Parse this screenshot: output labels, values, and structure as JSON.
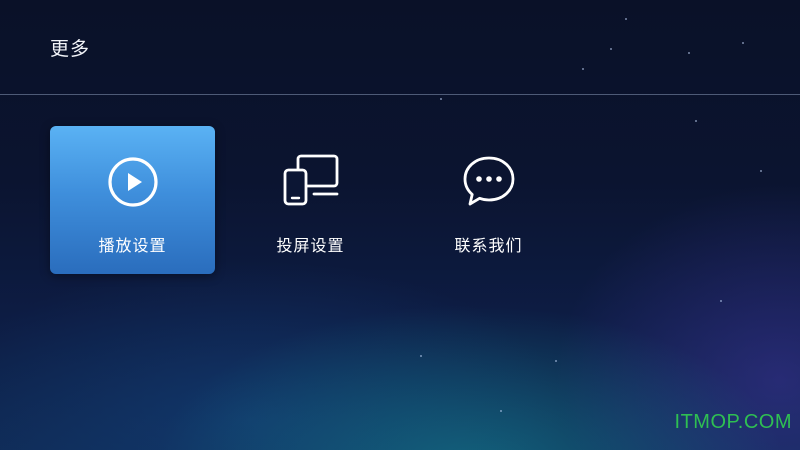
{
  "header": {
    "title": "更多"
  },
  "menu": {
    "items": [
      {
        "label": "播放设置",
        "icon": "play-icon",
        "selected": true
      },
      {
        "label": "投屏设置",
        "icon": "screen-cast-icon",
        "selected": false
      },
      {
        "label": "联系我们",
        "icon": "chat-icon",
        "selected": false
      }
    ]
  },
  "watermark": "ITMOP.COM",
  "colors": {
    "selected_tile_top": "#5ab2f4",
    "selected_tile_bottom": "#2a6dbd",
    "background": "#0b1430",
    "watermark": "#2fbf52"
  }
}
